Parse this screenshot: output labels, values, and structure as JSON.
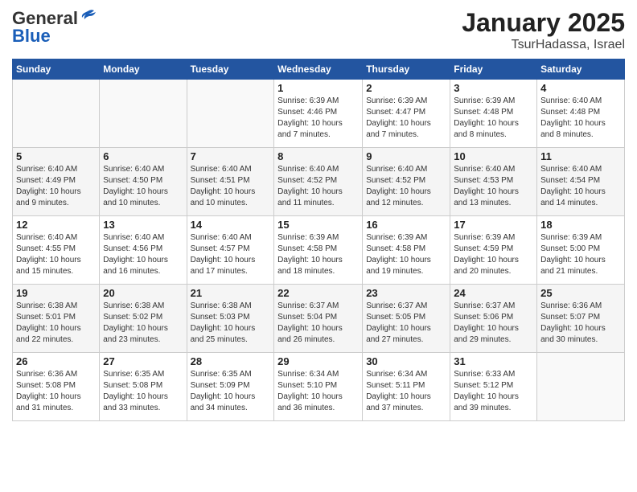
{
  "header": {
    "logo_line1": "General",
    "logo_line2": "Blue",
    "title": "January 2025",
    "subtitle": "TsurHadassa, Israel"
  },
  "calendar": {
    "weekdays": [
      "Sunday",
      "Monday",
      "Tuesday",
      "Wednesday",
      "Thursday",
      "Friday",
      "Saturday"
    ],
    "rows": [
      [
        {
          "day": "",
          "info": ""
        },
        {
          "day": "",
          "info": ""
        },
        {
          "day": "",
          "info": ""
        },
        {
          "day": "1",
          "info": "Sunrise: 6:39 AM\nSunset: 4:46 PM\nDaylight: 10 hours\nand 7 minutes."
        },
        {
          "day": "2",
          "info": "Sunrise: 6:39 AM\nSunset: 4:47 PM\nDaylight: 10 hours\nand 7 minutes."
        },
        {
          "day": "3",
          "info": "Sunrise: 6:39 AM\nSunset: 4:48 PM\nDaylight: 10 hours\nand 8 minutes."
        },
        {
          "day": "4",
          "info": "Sunrise: 6:40 AM\nSunset: 4:48 PM\nDaylight: 10 hours\nand 8 minutes."
        }
      ],
      [
        {
          "day": "5",
          "info": "Sunrise: 6:40 AM\nSunset: 4:49 PM\nDaylight: 10 hours\nand 9 minutes."
        },
        {
          "day": "6",
          "info": "Sunrise: 6:40 AM\nSunset: 4:50 PM\nDaylight: 10 hours\nand 10 minutes."
        },
        {
          "day": "7",
          "info": "Sunrise: 6:40 AM\nSunset: 4:51 PM\nDaylight: 10 hours\nand 10 minutes."
        },
        {
          "day": "8",
          "info": "Sunrise: 6:40 AM\nSunset: 4:52 PM\nDaylight: 10 hours\nand 11 minutes."
        },
        {
          "day": "9",
          "info": "Sunrise: 6:40 AM\nSunset: 4:52 PM\nDaylight: 10 hours\nand 12 minutes."
        },
        {
          "day": "10",
          "info": "Sunrise: 6:40 AM\nSunset: 4:53 PM\nDaylight: 10 hours\nand 13 minutes."
        },
        {
          "day": "11",
          "info": "Sunrise: 6:40 AM\nSunset: 4:54 PM\nDaylight: 10 hours\nand 14 minutes."
        }
      ],
      [
        {
          "day": "12",
          "info": "Sunrise: 6:40 AM\nSunset: 4:55 PM\nDaylight: 10 hours\nand 15 minutes."
        },
        {
          "day": "13",
          "info": "Sunrise: 6:40 AM\nSunset: 4:56 PM\nDaylight: 10 hours\nand 16 minutes."
        },
        {
          "day": "14",
          "info": "Sunrise: 6:40 AM\nSunset: 4:57 PM\nDaylight: 10 hours\nand 17 minutes."
        },
        {
          "day": "15",
          "info": "Sunrise: 6:39 AM\nSunset: 4:58 PM\nDaylight: 10 hours\nand 18 minutes."
        },
        {
          "day": "16",
          "info": "Sunrise: 6:39 AM\nSunset: 4:58 PM\nDaylight: 10 hours\nand 19 minutes."
        },
        {
          "day": "17",
          "info": "Sunrise: 6:39 AM\nSunset: 4:59 PM\nDaylight: 10 hours\nand 20 minutes."
        },
        {
          "day": "18",
          "info": "Sunrise: 6:39 AM\nSunset: 5:00 PM\nDaylight: 10 hours\nand 21 minutes."
        }
      ],
      [
        {
          "day": "19",
          "info": "Sunrise: 6:38 AM\nSunset: 5:01 PM\nDaylight: 10 hours\nand 22 minutes."
        },
        {
          "day": "20",
          "info": "Sunrise: 6:38 AM\nSunset: 5:02 PM\nDaylight: 10 hours\nand 23 minutes."
        },
        {
          "day": "21",
          "info": "Sunrise: 6:38 AM\nSunset: 5:03 PM\nDaylight: 10 hours\nand 25 minutes."
        },
        {
          "day": "22",
          "info": "Sunrise: 6:37 AM\nSunset: 5:04 PM\nDaylight: 10 hours\nand 26 minutes."
        },
        {
          "day": "23",
          "info": "Sunrise: 6:37 AM\nSunset: 5:05 PM\nDaylight: 10 hours\nand 27 minutes."
        },
        {
          "day": "24",
          "info": "Sunrise: 6:37 AM\nSunset: 5:06 PM\nDaylight: 10 hours\nand 29 minutes."
        },
        {
          "day": "25",
          "info": "Sunrise: 6:36 AM\nSunset: 5:07 PM\nDaylight: 10 hours\nand 30 minutes."
        }
      ],
      [
        {
          "day": "26",
          "info": "Sunrise: 6:36 AM\nSunset: 5:08 PM\nDaylight: 10 hours\nand 31 minutes."
        },
        {
          "day": "27",
          "info": "Sunrise: 6:35 AM\nSunset: 5:08 PM\nDaylight: 10 hours\nand 33 minutes."
        },
        {
          "day": "28",
          "info": "Sunrise: 6:35 AM\nSunset: 5:09 PM\nDaylight: 10 hours\nand 34 minutes."
        },
        {
          "day": "29",
          "info": "Sunrise: 6:34 AM\nSunset: 5:10 PM\nDaylight: 10 hours\nand 36 minutes."
        },
        {
          "day": "30",
          "info": "Sunrise: 6:34 AM\nSunset: 5:11 PM\nDaylight: 10 hours\nand 37 minutes."
        },
        {
          "day": "31",
          "info": "Sunrise: 6:33 AM\nSunset: 5:12 PM\nDaylight: 10 hours\nand 39 minutes."
        },
        {
          "day": "",
          "info": ""
        }
      ]
    ]
  }
}
